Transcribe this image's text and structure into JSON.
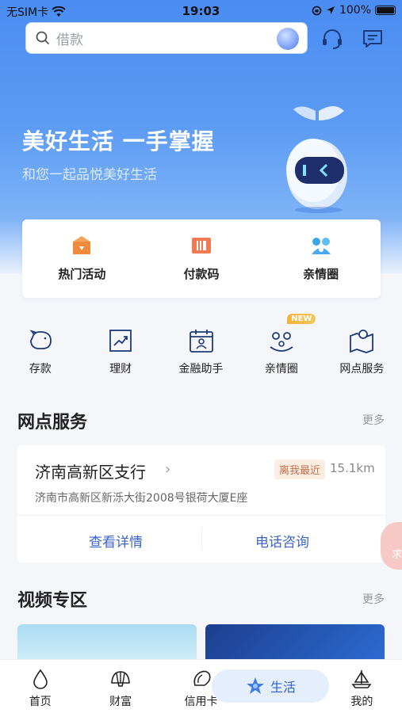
{
  "status_bar": {
    "carrier": "无SIM卡",
    "time": "19:03",
    "battery": "100%"
  },
  "search": {
    "placeholder": "借款"
  },
  "hero": {
    "title": "美好生活 一手掌握",
    "subtitle": "和您一起品悦美好生活"
  },
  "quick_actions": [
    {
      "label": "热门活动",
      "icon": "hot-activity-icon"
    },
    {
      "label": "付款码",
      "icon": "payment-code-icon"
    },
    {
      "label": "亲情圈",
      "icon": "family-circle-icon"
    }
  ],
  "services": [
    {
      "label": "存款",
      "icon": "piggy-bank-icon"
    },
    {
      "label": "理财",
      "icon": "chart-trend-icon"
    },
    {
      "label": "金融助手",
      "icon": "calendar-person-icon"
    },
    {
      "label": "亲情圈",
      "icon": "family-icon",
      "badge": "NEW"
    },
    {
      "label": "网点服务",
      "icon": "map-pin-icon"
    }
  ],
  "branch_section": {
    "title": "网点服务",
    "more": "更多",
    "branch": {
      "name": "济南高新区支行",
      "tag": "离我最近",
      "distance": "15.1km",
      "address": "济南市高新区新泺大街2008号银荷大厦E座",
      "detail_button": "查看详情",
      "call_button": "电话咨询"
    }
  },
  "float_tab": {
    "label": "求"
  },
  "video_section": {
    "title": "视频专区",
    "more": "更多"
  },
  "tabbar": {
    "items": [
      {
        "label": "首页",
        "icon": "home-drop-icon"
      },
      {
        "label": "财富",
        "icon": "shell-icon"
      },
      {
        "label": "信用卡",
        "icon": "conch-icon"
      },
      {
        "label": "生活",
        "icon": "star-icon",
        "active": true
      },
      {
        "label": "我的",
        "icon": "sailboat-icon"
      }
    ]
  },
  "colors": {
    "brand_blue": "#4a8cf2",
    "link_blue": "#3d64c9",
    "new_badge": "#f6b13a"
  }
}
